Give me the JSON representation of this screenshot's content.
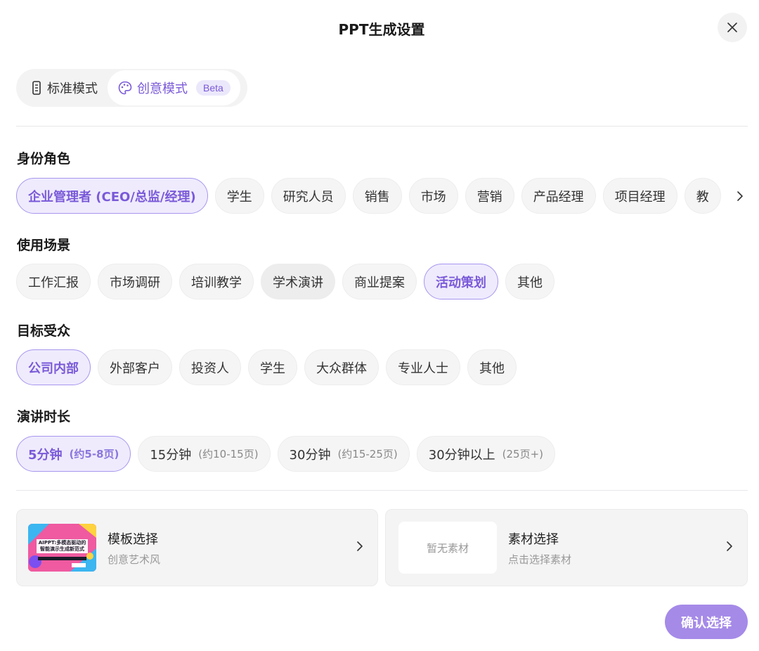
{
  "dialog": {
    "title": "PPT生成设置"
  },
  "modes": {
    "standard_label": "标准模式",
    "creative_label": "创意模式",
    "beta_badge": "Beta"
  },
  "sections": {
    "role": {
      "label": "身份角色",
      "options": [
        "企业管理者 (CEO/总监/经理)",
        "学生",
        "研究人员",
        "销售",
        "市场",
        "营销",
        "产品经理",
        "项目经理",
        "教"
      ],
      "selected": "企业管理者 (CEO/总监/经理)"
    },
    "scenario": {
      "label": "使用场景",
      "options": [
        "工作汇报",
        "市场调研",
        "培训教学",
        "学术演讲",
        "商业提案",
        "活动策划",
        "其他"
      ],
      "selected": "活动策划"
    },
    "audience": {
      "label": "目标受众",
      "options": [
        "公司内部",
        "外部客户",
        "投资人",
        "学生",
        "大众群体",
        "专业人士",
        "其他"
      ],
      "selected": "公司内部"
    },
    "duration": {
      "label": "演讲时长",
      "options": [
        {
          "main": "5分钟",
          "sub": "(约5-8页)"
        },
        {
          "main": "15分钟",
          "sub": "(约10-15页)"
        },
        {
          "main": "30分钟",
          "sub": "(约15-25页)"
        },
        {
          "main": "30分钟以上",
          "sub": "(25页+)"
        }
      ],
      "selected": "5分钟"
    }
  },
  "template_card": {
    "title": "模板选择",
    "subtitle": "创意艺术风",
    "thumb_text": "AIPPT:多模态驱动的智能演示生成新范式"
  },
  "material_card": {
    "title": "素材选择",
    "subtitle": "点击选择素材",
    "empty_text": "暂无素材"
  },
  "confirm_label": "确认选择",
  "colors": {
    "accent": "#7a5ad8",
    "accent_bg": "#efebfd",
    "confirm_bg": "#a58ae8"
  }
}
